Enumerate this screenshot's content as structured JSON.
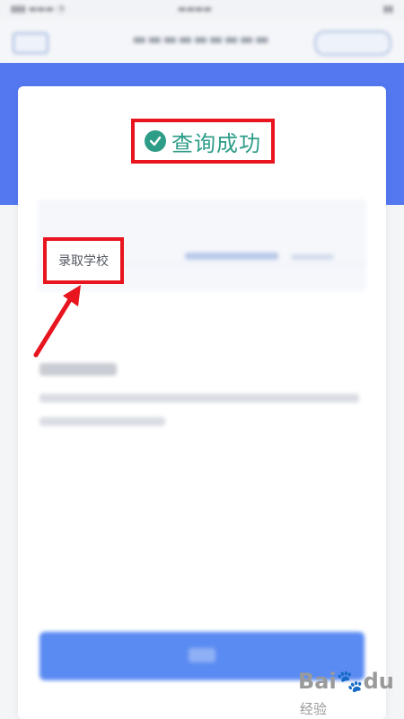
{
  "result": {
    "status_text": "查询成功",
    "field_label": "录取学校"
  },
  "watermark": {
    "brand": "Bai",
    "brand_suffix": "du",
    "sub": "经验"
  },
  "colors": {
    "banner": "#5478f0",
    "success": "#2d9d88",
    "highlight": "#e8141e",
    "button": "#5a8bf2"
  }
}
